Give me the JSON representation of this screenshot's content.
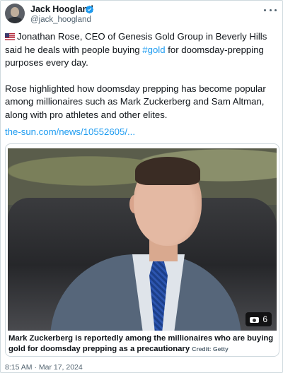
{
  "author": {
    "display_name": "Jack Hoogland",
    "handle": "@jack_hoogland",
    "verified": true
  },
  "tweet": {
    "flag_icon": "us-flag-icon",
    "para1_before_hashtag": "Jonathan Rose, CEO of Genesis Gold Group in Beverly Hills said he deals with people buying ",
    "hashtag": "#gold",
    "para1_after_hashtag": " for doomsday-prepping purposes every day.",
    "para2": "Rose highlighted how doomsday prepping has become popular among millionaires such as Mark Zuckerberg and Sam Altman, along with pro athletes and other elites.",
    "link": "the-sun.com/news/10552605/..."
  },
  "media": {
    "photo_count": "6",
    "caption": "Mark Zuckerberg is reportedly among the millionaires who are buying gold for doomsday prepping as a precautionary",
    "credit": "Credit: Getty"
  },
  "meta": {
    "timestamp": "8:15 AM · Mar 17, 2024"
  },
  "colors": {
    "link": "#1d9bf0",
    "verified": "#1d9bf0",
    "secondary_text": "#536471"
  }
}
